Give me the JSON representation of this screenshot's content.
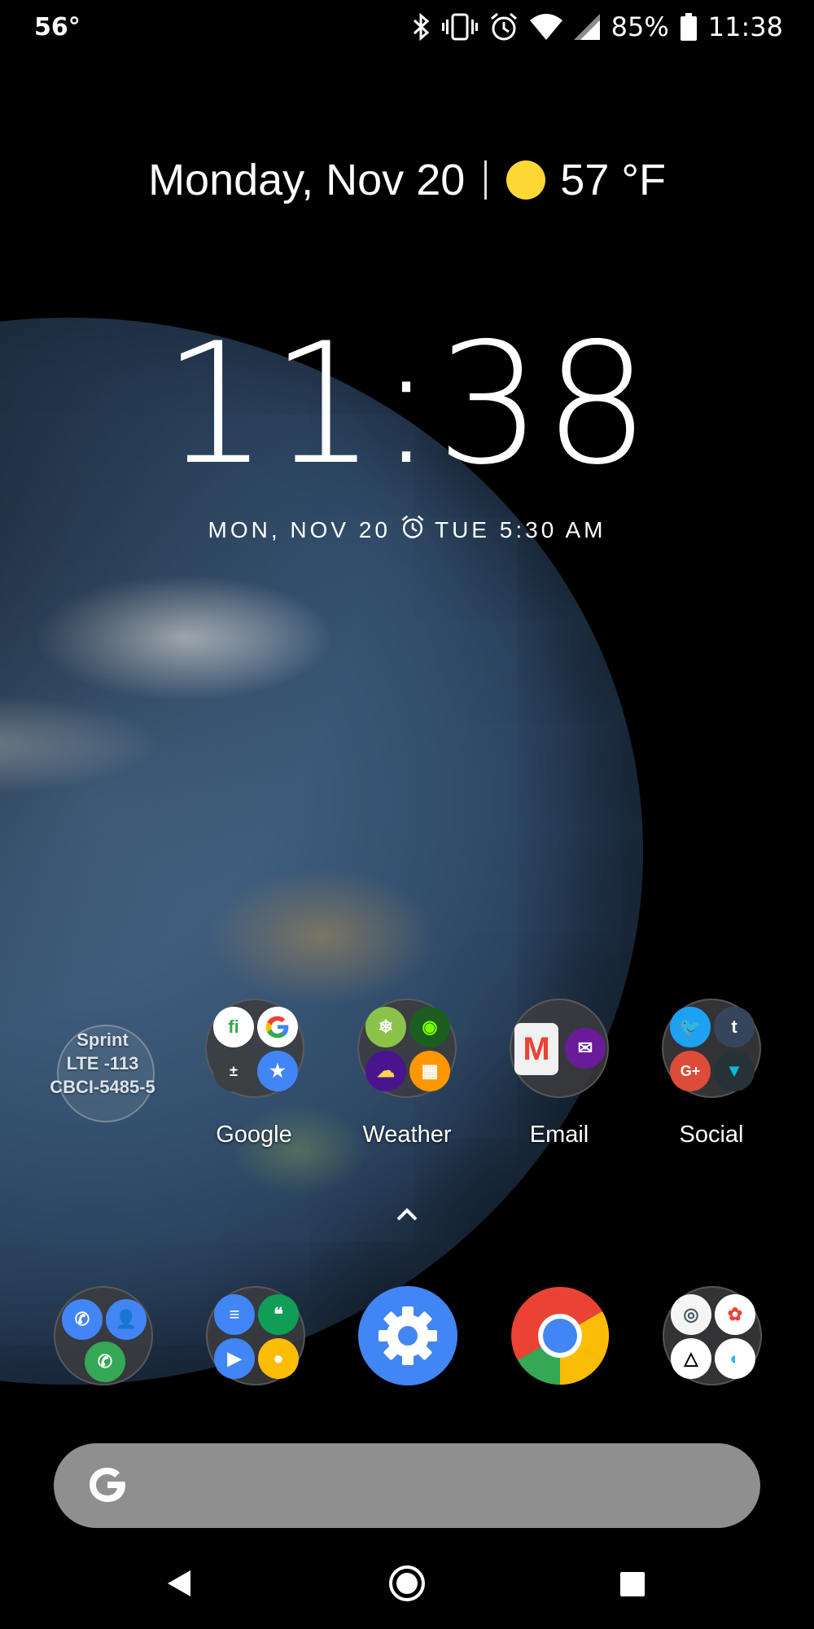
{
  "status_bar": {
    "temperature": "56°",
    "battery": "85%",
    "time": "11:38"
  },
  "glance": {
    "date": "Monday, Nov 20",
    "weather_temp": "57 °F"
  },
  "clock": {
    "time": "11:38",
    "date": "MON, NOV 20",
    "alarm": "TUE 5:30 AM"
  },
  "widget": {
    "lines": [
      "Sprint",
      "LTE -113",
      "CBCI-5485-5"
    ]
  },
  "row": [
    {
      "label": "Google"
    },
    {
      "label": "Weather"
    },
    {
      "label": "Email"
    },
    {
      "label": "Social"
    }
  ],
  "colors": {
    "google_blue": "#4285f4",
    "google_red": "#ea4335",
    "google_yellow": "#fbbc05",
    "google_green": "#34a853",
    "search_bar": "#8f8f8f",
    "sun": "#fdd835"
  },
  "icons": {
    "status": [
      "bluetooth-icon",
      "vibrate-icon",
      "alarm-icon",
      "wifi-icon",
      "signal-icon",
      "battery-icon"
    ],
    "dock": [
      "phone-folder-icon",
      "messaging-folder-icon",
      "settings-icon",
      "chrome-icon",
      "camera-folder-icon"
    ],
    "nav": [
      "back-icon",
      "home-icon",
      "recents-icon"
    ]
  }
}
